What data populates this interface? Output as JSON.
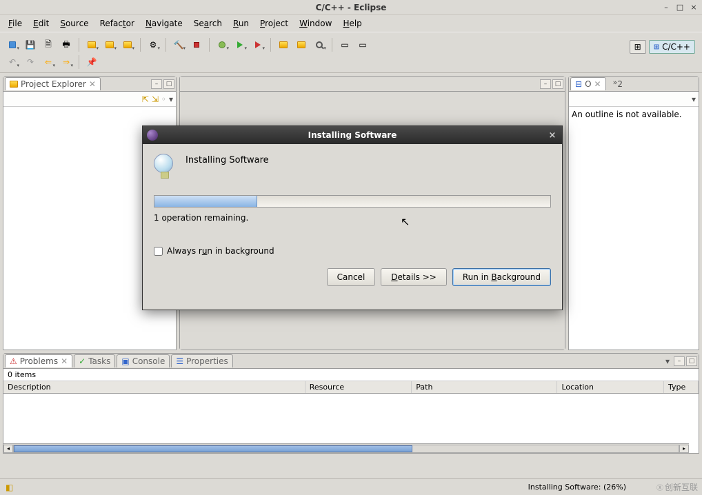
{
  "window": {
    "title": "C/C++ - Eclipse"
  },
  "menu": {
    "file": "File",
    "edit": "Edit",
    "source": "Source",
    "refactor": "Refactor",
    "navigate": "Navigate",
    "search": "Search",
    "run": "Run",
    "project": "Project",
    "window": "Window",
    "help": "Help"
  },
  "perspective": {
    "label": "C/C++"
  },
  "projectExplorer": {
    "title": "Project Explorer"
  },
  "outline": {
    "title": "O",
    "message": "An outline is not available."
  },
  "problems": {
    "tabs": {
      "problems": "Problems",
      "tasks": "Tasks",
      "console": "Console",
      "properties": "Properties"
    },
    "count": "0 items",
    "columns": {
      "description": "Description",
      "resource": "Resource",
      "path": "Path",
      "location": "Location",
      "type": "Type"
    }
  },
  "status": {
    "progress": "Installing Software: (26%)"
  },
  "dialog": {
    "title": "Installing Software",
    "heading": "Installing Software",
    "remaining": "1 operation remaining.",
    "checkbox": "Always run in background",
    "buttons": {
      "cancel": "Cancel",
      "details": "Details >>",
      "background": "Run in Background"
    },
    "progress_percent": 26
  },
  "watermark": "创新互联"
}
